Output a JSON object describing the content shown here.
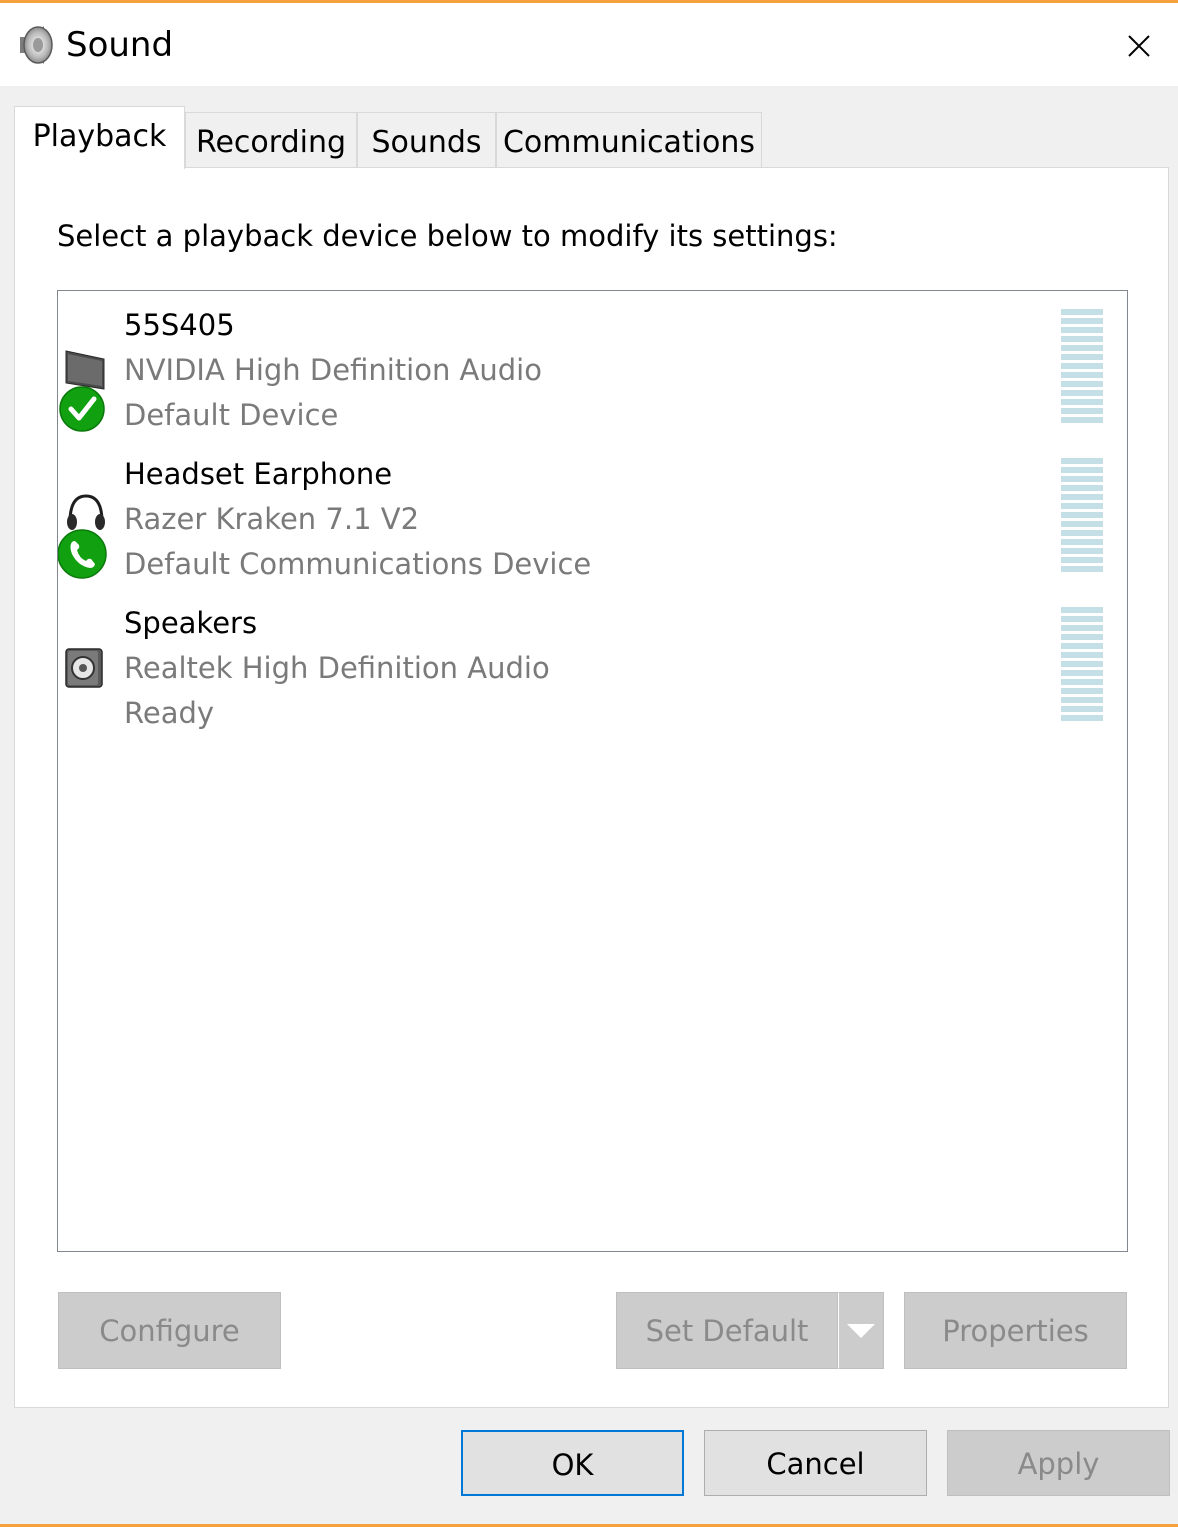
{
  "window": {
    "title": "Sound",
    "accent_color": "#f4a13e"
  },
  "tabs": [
    {
      "label": "Playback",
      "active": true
    },
    {
      "label": "Recording",
      "active": false
    },
    {
      "label": "Sounds",
      "active": false
    },
    {
      "label": "Communications",
      "active": false
    }
  ],
  "playback": {
    "instruction": "Select a playback device below to modify its settings:",
    "devices": [
      {
        "name": "55S405",
        "driver": "NVIDIA High Definition Audio",
        "status": "Default Device",
        "icon": "monitor-icon",
        "badge": "default-check-icon"
      },
      {
        "name": "Headset Earphone",
        "driver": "Razer Kraken 7.1 V2",
        "status": "Default Communications Device",
        "icon": "headset-icon",
        "badge": "phone-badge-icon"
      },
      {
        "name": "Speakers",
        "driver": "Realtek High Definition Audio",
        "status": "Ready",
        "icon": "speaker-icon",
        "badge": ""
      }
    ],
    "buttons": {
      "configure": "Configure",
      "set_default": "Set Default",
      "properties": "Properties"
    }
  },
  "footer": {
    "ok": "OK",
    "cancel": "Cancel",
    "apply": "Apply"
  },
  "colors": {
    "focus_border": "#0078d7",
    "badge_green": "#10a010",
    "meter_bar": "#c5dfe6"
  }
}
